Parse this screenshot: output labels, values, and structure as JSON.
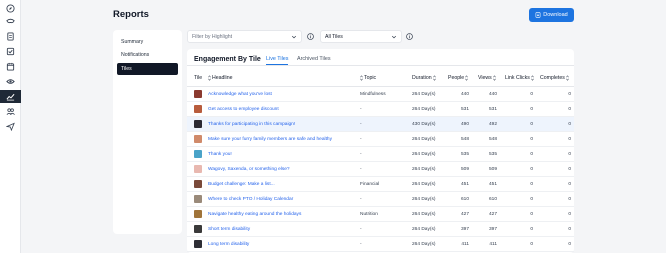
{
  "sidebar": {
    "icons": [
      "compass-icon",
      "eye-mask-icon",
      "document-icon",
      "checkbox-icon",
      "calendar-icon",
      "eye-icon",
      "reports-chart-icon",
      "users-icon",
      "send-icon"
    ],
    "active": "reports-chart-icon"
  },
  "header": {
    "title": "Reports",
    "download_label": "Download"
  },
  "subnav": {
    "items": [
      "Summary",
      "Notifications",
      "Tiles"
    ],
    "active": "Tiles"
  },
  "filters": {
    "highlight_placeholder": "Filter by Highlight",
    "tiles_value": "All Tiles"
  },
  "engagement": {
    "title": "Engagement By Tile",
    "tabs": [
      "Live Tiles",
      "Archived Tiles"
    ],
    "active_tab": "Live Tiles",
    "columns": [
      "Tile",
      "Headline",
      "Topic",
      "Duration",
      "People",
      "Views",
      "Link Clicks",
      "Completes"
    ],
    "rows": [
      {
        "headline": "Acknowledge what you've lost",
        "topic": "Mindfulness",
        "duration": "264 Day(s)",
        "people": "440",
        "views": "440",
        "clicks": "0",
        "completes": "0",
        "thumb": "#8b3a2f"
      },
      {
        "headline": "Get access to employee discount",
        "topic": "-",
        "duration": "264 Day(s)",
        "people": "531",
        "views": "531",
        "clicks": "0",
        "completes": "0",
        "thumb": "#b85c3c"
      },
      {
        "headline": "Thanks for participating in this campaign!",
        "topic": "-",
        "duration": "430 Day(s)",
        "people": "490",
        "views": "492",
        "clicks": "0",
        "completes": "0",
        "thumb": "#2b2a33"
      },
      {
        "headline": "Make sure your furry family members are safe and healthy",
        "topic": "-",
        "duration": "264 Day(s)",
        "people": "548",
        "views": "548",
        "clicks": "0",
        "completes": "0",
        "thumb": "#d08a6a"
      },
      {
        "headline": "Thank you!",
        "topic": "-",
        "duration": "264 Day(s)",
        "people": "535",
        "views": "535",
        "clicks": "0",
        "completes": "0",
        "thumb": "#4aa3c8"
      },
      {
        "headline": "Wagovy, Saxenda, or something else?",
        "topic": "-",
        "duration": "264 Day(s)",
        "people": "509",
        "views": "509",
        "clicks": "0",
        "completes": "0",
        "thumb": "#e8b8b0"
      },
      {
        "headline": "Budget challenge: Make a list...",
        "topic": "Financial",
        "duration": "264 Day(s)",
        "people": "451",
        "views": "451",
        "clicks": "0",
        "completes": "0",
        "thumb": "#7a4a3a"
      },
      {
        "headline": "Where to check PTO / Holiday Calendar",
        "topic": "-",
        "duration": "264 Day(s)",
        "people": "610",
        "views": "610",
        "clicks": "0",
        "completes": "0",
        "thumb": "#9a8a7a"
      },
      {
        "headline": "Navigate healthy eating around the holidays",
        "topic": "Nutrition",
        "duration": "264 Day(s)",
        "people": "427",
        "views": "427",
        "clicks": "0",
        "completes": "0",
        "thumb": "#a0743a"
      },
      {
        "headline": "Short term disability",
        "topic": "-",
        "duration": "264 Day(s)",
        "people": "397",
        "views": "397",
        "clicks": "0",
        "completes": "0",
        "thumb": "#3a3a3a"
      },
      {
        "headline": "Long term disability",
        "topic": "-",
        "duration": "264 Day(s)",
        "people": "411",
        "views": "411",
        "clicks": "0",
        "completes": "0",
        "thumb": "#2e2e35"
      }
    ]
  },
  "colors": {
    "accent": "#1d74e0",
    "link": "#2563eb",
    "dark": "#111827",
    "highlight_row": "#eef4fd"
  }
}
